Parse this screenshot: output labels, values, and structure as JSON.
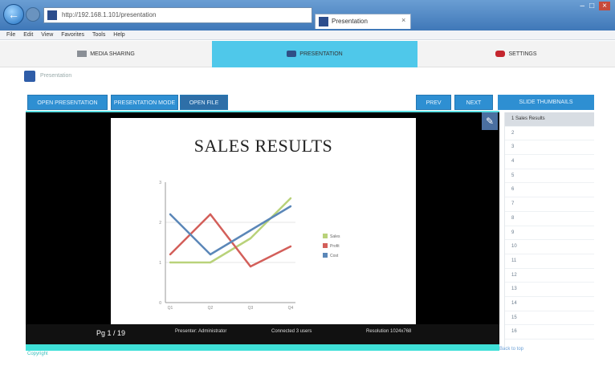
{
  "browser": {
    "address": "http://192.168.1.101/presentation",
    "tab_title": "Presentation",
    "menu": [
      "File",
      "Edit",
      "View",
      "Favorites",
      "Tools",
      "Help"
    ]
  },
  "nav": {
    "items": [
      {
        "label": "MEDIA SHARING",
        "active": false
      },
      {
        "label": "PRESENTATION",
        "active": true
      },
      {
        "label": "SETTINGS",
        "active": false
      }
    ]
  },
  "breadcrumb": "Presentation",
  "toolbar": {
    "left": [
      "OPEN PRESENTATION",
      "PRESENTATION MODE",
      "OPEN FILE"
    ],
    "right": [
      "PREV",
      "NEXT"
    ],
    "thumbs_header": "SLIDE THUMBNAILS"
  },
  "slide": {
    "title": "SALES RESULTS"
  },
  "chart_data": {
    "type": "line",
    "title": "SALES RESULTS",
    "categories": [
      "Q1",
      "Q2",
      "Q3",
      "Q4"
    ],
    "ylim": [
      0,
      3
    ],
    "series": [
      {
        "name": "Sales",
        "values": [
          1.0,
          1.0,
          1.6,
          2.6
        ],
        "color": "#b9d27a"
      },
      {
        "name": "Profit",
        "values": [
          1.2,
          2.2,
          0.9,
          1.4
        ],
        "color": "#d35f5a"
      },
      {
        "name": "Cost",
        "values": [
          2.2,
          1.2,
          1.8,
          2.4
        ],
        "color": "#5b87b8"
      }
    ],
    "legend": "right"
  },
  "status": {
    "page": "Pg 1 / 19",
    "info1": "Presenter: Administrator",
    "info2": "Connected 3 users",
    "info3": "Resolution 1024x768"
  },
  "thumbs": [
    "1 Sales Results",
    "2",
    "3",
    "4",
    "5",
    "6",
    "7",
    "8",
    "9",
    "10",
    "11",
    "12",
    "13",
    "14",
    "15",
    "16"
  ],
  "footer": {
    "left": "Copyright",
    "right": "Back to top"
  }
}
